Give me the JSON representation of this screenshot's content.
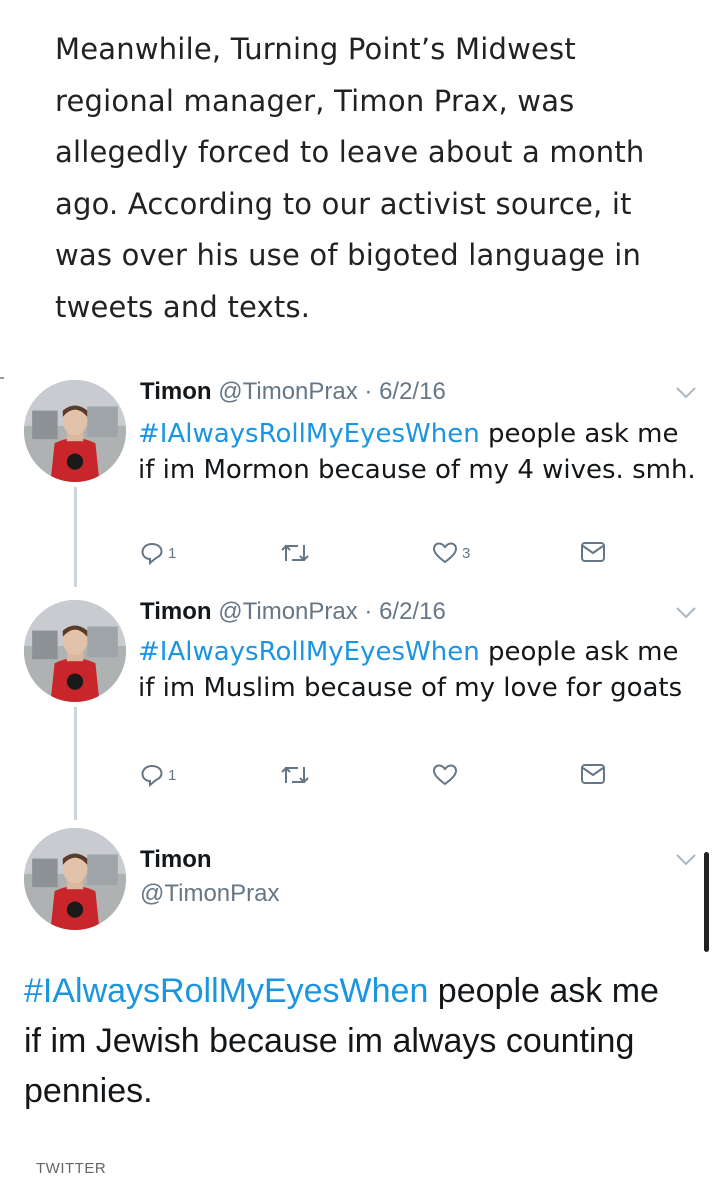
{
  "article": {
    "intro": "Meanwhile, Turning Point’s Midwest regional manager, Timon Prax, was allegedly forced to leave about a month ago. According to our activist source, it was over his use of bigoted language in tweets and texts."
  },
  "tweets": [
    {
      "name": "Timon",
      "handle": "@TimonPrax",
      "date": "· 6/2/16",
      "hashtag": "#IAlwaysRollMyEyesWhen",
      "text": " people ask me if im Mormon because of my 4 wives. smh.",
      "replies": "1",
      "likes": "3"
    },
    {
      "name": "Timon",
      "handle": "@TimonPrax",
      "date": "· 6/2/16",
      "hashtag": "#IAlwaysRollMyEyesWhen",
      "text": " people ask me if im Muslim because of my love for goats",
      "replies": "1",
      "likes": ""
    }
  ],
  "expanded_tweet": {
    "name": "Timon",
    "handle": "@TimonPrax",
    "hashtag": "#IAlwaysRollMyEyesWhen",
    "text": " people ask me if im Jewish because im always counting pennies."
  },
  "footer": {
    "source": "TWITTER"
  },
  "icons": [
    "reply-icon",
    "retweet-icon",
    "heart-icon",
    "dm-icon",
    "chevron-down-icon"
  ],
  "colors": {
    "hashtag": "#1b95e0",
    "muted": "#657786",
    "thread": "#ccd6dd"
  }
}
